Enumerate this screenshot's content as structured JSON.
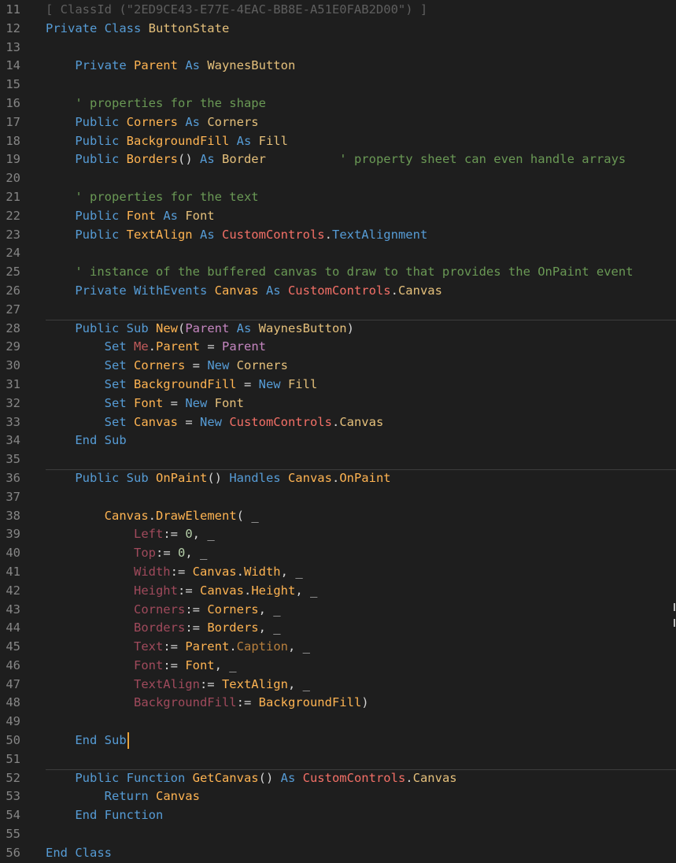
{
  "colors": {
    "background": "#1e1e1e",
    "line_number": "#858585",
    "keyword": "#569cd6",
    "identifier": "#ffb452",
    "comment": "#6a9955",
    "class_ref": "#f47067",
    "named_arg": "#a04a5c",
    "cursor": "#e8a23a"
  },
  "editor": {
    "cursor_line": 50,
    "lines": [
      {
        "no": "11",
        "tokens": [
          {
            "t": "[ ClassId (\"2ED9CE43-E77E-4EAC-BB8E-A51E0FAB2D00\") ]",
            "c": "dim"
          }
        ]
      },
      {
        "no": "12",
        "tokens": [
          {
            "t": "Private Class ",
            "c": "kw"
          },
          {
            "t": "ButtonState",
            "c": "type"
          }
        ]
      },
      {
        "no": "13",
        "tokens": []
      },
      {
        "no": "14",
        "tokens": [
          {
            "t": "    Private ",
            "c": "kw"
          },
          {
            "t": "Parent",
            "c": "id"
          },
          {
            "t": " As ",
            "c": "kw"
          },
          {
            "t": "WaynesButton",
            "c": "type"
          }
        ]
      },
      {
        "no": "15",
        "tokens": []
      },
      {
        "no": "16",
        "tokens": [
          {
            "t": "    ' properties for the shape",
            "c": "comment"
          }
        ]
      },
      {
        "no": "17",
        "tokens": [
          {
            "t": "    Public ",
            "c": "kw"
          },
          {
            "t": "Corners",
            "c": "id"
          },
          {
            "t": " As ",
            "c": "kw"
          },
          {
            "t": "Corners",
            "c": "type"
          }
        ]
      },
      {
        "no": "18",
        "tokens": [
          {
            "t": "    Public ",
            "c": "kw"
          },
          {
            "t": "BackgroundFill",
            "c": "id"
          },
          {
            "t": " As ",
            "c": "kw"
          },
          {
            "t": "Fill",
            "c": "type"
          }
        ]
      },
      {
        "no": "19",
        "tokens": [
          {
            "t": "    Public ",
            "c": "kw"
          },
          {
            "t": "Borders",
            "c": "id"
          },
          {
            "t": "()",
            "c": "plain"
          },
          {
            "t": " As ",
            "c": "kw"
          },
          {
            "t": "Border",
            "c": "type"
          },
          {
            "t": "          ' property sheet can even handle arrays",
            "c": "comment"
          }
        ]
      },
      {
        "no": "20",
        "tokens": []
      },
      {
        "no": "21",
        "tokens": [
          {
            "t": "    ' properties for the text",
            "c": "comment"
          }
        ]
      },
      {
        "no": "22",
        "tokens": [
          {
            "t": "    Public ",
            "c": "kw"
          },
          {
            "t": "Font",
            "c": "id"
          },
          {
            "t": " As ",
            "c": "kw"
          },
          {
            "t": "Font",
            "c": "type"
          }
        ]
      },
      {
        "no": "23",
        "tokens": [
          {
            "t": "    Public ",
            "c": "kw"
          },
          {
            "t": "TextAlign",
            "c": "id"
          },
          {
            "t": " As ",
            "c": "kw"
          },
          {
            "t": "CustomControls",
            "c": "cls"
          },
          {
            "t": ".",
            "c": "plain"
          },
          {
            "t": "TextAlignment",
            "c": "kw"
          }
        ]
      },
      {
        "no": "24",
        "tokens": []
      },
      {
        "no": "25",
        "tokens": [
          {
            "t": "    ' instance of the buffered canvas to draw to that provides the OnPaint event",
            "c": "comment"
          }
        ]
      },
      {
        "no": "26",
        "tokens": [
          {
            "t": "    Private WithEvents ",
            "c": "kw"
          },
          {
            "t": "Canvas",
            "c": "id"
          },
          {
            "t": " As ",
            "c": "kw"
          },
          {
            "t": "CustomControls",
            "c": "cls"
          },
          {
            "t": ".",
            "c": "plain"
          },
          {
            "t": "Canvas",
            "c": "type"
          }
        ]
      },
      {
        "no": "27",
        "tokens": []
      },
      {
        "no": "28",
        "sep": true,
        "tokens": [
          {
            "t": "    Public Sub ",
            "c": "kw"
          },
          {
            "t": "New",
            "c": "id"
          },
          {
            "t": "(",
            "c": "plain"
          },
          {
            "t": "Parent",
            "c": "param"
          },
          {
            "t": " As ",
            "c": "kw"
          },
          {
            "t": "WaynesButton",
            "c": "type"
          },
          {
            "t": ")",
            "c": "plain"
          }
        ]
      },
      {
        "no": "29",
        "tokens": [
          {
            "t": "        Set ",
            "c": "kw"
          },
          {
            "t": "Me",
            "c": "me"
          },
          {
            "t": ".",
            "c": "plain"
          },
          {
            "t": "Parent",
            "c": "id"
          },
          {
            "t": " = ",
            "c": "plain"
          },
          {
            "t": "Parent",
            "c": "param"
          }
        ]
      },
      {
        "no": "30",
        "tokens": [
          {
            "t": "        Set ",
            "c": "kw"
          },
          {
            "t": "Corners",
            "c": "id"
          },
          {
            "t": " = ",
            "c": "plain"
          },
          {
            "t": "New ",
            "c": "kw"
          },
          {
            "t": "Corners",
            "c": "type"
          }
        ]
      },
      {
        "no": "31",
        "tokens": [
          {
            "t": "        Set ",
            "c": "kw"
          },
          {
            "t": "BackgroundFill",
            "c": "id"
          },
          {
            "t": " = ",
            "c": "plain"
          },
          {
            "t": "New ",
            "c": "kw"
          },
          {
            "t": "Fill",
            "c": "type"
          }
        ]
      },
      {
        "no": "32",
        "tokens": [
          {
            "t": "        Set ",
            "c": "kw"
          },
          {
            "t": "Font",
            "c": "id"
          },
          {
            "t": " = ",
            "c": "plain"
          },
          {
            "t": "New ",
            "c": "kw"
          },
          {
            "t": "Font",
            "c": "type"
          }
        ]
      },
      {
        "no": "33",
        "tokens": [
          {
            "t": "        Set ",
            "c": "kw"
          },
          {
            "t": "Canvas",
            "c": "id"
          },
          {
            "t": " = ",
            "c": "plain"
          },
          {
            "t": "New ",
            "c": "kw"
          },
          {
            "t": "CustomControls",
            "c": "cls"
          },
          {
            "t": ".",
            "c": "plain"
          },
          {
            "t": "Canvas",
            "c": "type"
          }
        ]
      },
      {
        "no": "34",
        "tokens": [
          {
            "t": "    End Sub",
            "c": "kw"
          }
        ]
      },
      {
        "no": "35",
        "tokens": []
      },
      {
        "no": "36",
        "sep": true,
        "tokens": [
          {
            "t": "    Public Sub ",
            "c": "kw"
          },
          {
            "t": "OnPaint",
            "c": "id"
          },
          {
            "t": "() ",
            "c": "plain"
          },
          {
            "t": "Handles ",
            "c": "kw"
          },
          {
            "t": "Canvas",
            "c": "id"
          },
          {
            "t": ".",
            "c": "plain"
          },
          {
            "t": "OnPaint",
            "c": "id"
          }
        ]
      },
      {
        "no": "37",
        "tokens": []
      },
      {
        "no": "38",
        "tokens": [
          {
            "t": "        Canvas",
            "c": "id"
          },
          {
            "t": ".",
            "c": "plain"
          },
          {
            "t": "DrawElement",
            "c": "id"
          },
          {
            "t": "( _",
            "c": "plain"
          }
        ]
      },
      {
        "no": "39",
        "tokens": [
          {
            "t": "            Left",
            "c": "named"
          },
          {
            "t": ":= ",
            "c": "plain"
          },
          {
            "t": "0",
            "c": "num"
          },
          {
            "t": ", _",
            "c": "plain"
          }
        ]
      },
      {
        "no": "40",
        "tokens": [
          {
            "t": "            Top",
            "c": "named"
          },
          {
            "t": ":= ",
            "c": "plain"
          },
          {
            "t": "0",
            "c": "num"
          },
          {
            "t": ", _",
            "c": "plain"
          }
        ]
      },
      {
        "no": "41",
        "tokens": [
          {
            "t": "            Width",
            "c": "named"
          },
          {
            "t": ":= ",
            "c": "plain"
          },
          {
            "t": "Canvas",
            "c": "id"
          },
          {
            "t": ".",
            "c": "plain"
          },
          {
            "t": "Width",
            "c": "id"
          },
          {
            "t": ", _",
            "c": "plain"
          }
        ]
      },
      {
        "no": "42",
        "tokens": [
          {
            "t": "            Height",
            "c": "named"
          },
          {
            "t": ":= ",
            "c": "plain"
          },
          {
            "t": "Canvas",
            "c": "id"
          },
          {
            "t": ".",
            "c": "plain"
          },
          {
            "t": "Height",
            "c": "id"
          },
          {
            "t": ", _",
            "c": "plain"
          }
        ]
      },
      {
        "no": "43",
        "tokens": [
          {
            "t": "            Corners",
            "c": "named"
          },
          {
            "t": ":= ",
            "c": "plain"
          },
          {
            "t": "Corners",
            "c": "id"
          },
          {
            "t": ", _",
            "c": "plain"
          }
        ]
      },
      {
        "no": "44",
        "tokens": [
          {
            "t": "            Borders",
            "c": "named"
          },
          {
            "t": ":= ",
            "c": "plain"
          },
          {
            "t": "Borders",
            "c": "id"
          },
          {
            "t": ", _",
            "c": "plain"
          }
        ]
      },
      {
        "no": "45",
        "tokens": [
          {
            "t": "            Text",
            "c": "named"
          },
          {
            "t": ":= ",
            "c": "plain"
          },
          {
            "t": "Parent",
            "c": "id"
          },
          {
            "t": ".",
            "c": "plain"
          },
          {
            "t": "Caption",
            "c": "cap"
          },
          {
            "t": ", _",
            "c": "plain"
          }
        ]
      },
      {
        "no": "46",
        "tokens": [
          {
            "t": "            Font",
            "c": "named"
          },
          {
            "t": ":= ",
            "c": "plain"
          },
          {
            "t": "Font",
            "c": "id"
          },
          {
            "t": ", _",
            "c": "plain"
          }
        ]
      },
      {
        "no": "47",
        "tokens": [
          {
            "t": "            TextAlign",
            "c": "named"
          },
          {
            "t": ":= ",
            "c": "plain"
          },
          {
            "t": "TextAlign",
            "c": "id"
          },
          {
            "t": ", _",
            "c": "plain"
          }
        ]
      },
      {
        "no": "48",
        "tokens": [
          {
            "t": "            BackgroundFill",
            "c": "named"
          },
          {
            "t": ":= ",
            "c": "plain"
          },
          {
            "t": "BackgroundFill",
            "c": "id"
          },
          {
            "t": ")",
            "c": "plain"
          }
        ]
      },
      {
        "no": "49",
        "tokens": []
      },
      {
        "no": "50",
        "tokens": [
          {
            "t": "    End Sub",
            "c": "kw"
          }
        ]
      },
      {
        "no": "51",
        "tokens": []
      },
      {
        "no": "52",
        "sep": true,
        "tokens": [
          {
            "t": "    Public Function ",
            "c": "kw"
          },
          {
            "t": "GetCanvas",
            "c": "id"
          },
          {
            "t": "()",
            "c": "plain"
          },
          {
            "t": " As ",
            "c": "kw"
          },
          {
            "t": "CustomControls",
            "c": "cls"
          },
          {
            "t": ".",
            "c": "plain"
          },
          {
            "t": "Canvas",
            "c": "type"
          }
        ]
      },
      {
        "no": "53",
        "tokens": [
          {
            "t": "        Return ",
            "c": "kw"
          },
          {
            "t": "Canvas",
            "c": "id"
          }
        ]
      },
      {
        "no": "54",
        "tokens": [
          {
            "t": "    End Function",
            "c": "kw"
          }
        ]
      },
      {
        "no": "55",
        "tokens": []
      },
      {
        "no": "56",
        "tokens": [
          {
            "t": "End Class",
            "c": "kw"
          }
        ]
      }
    ]
  }
}
